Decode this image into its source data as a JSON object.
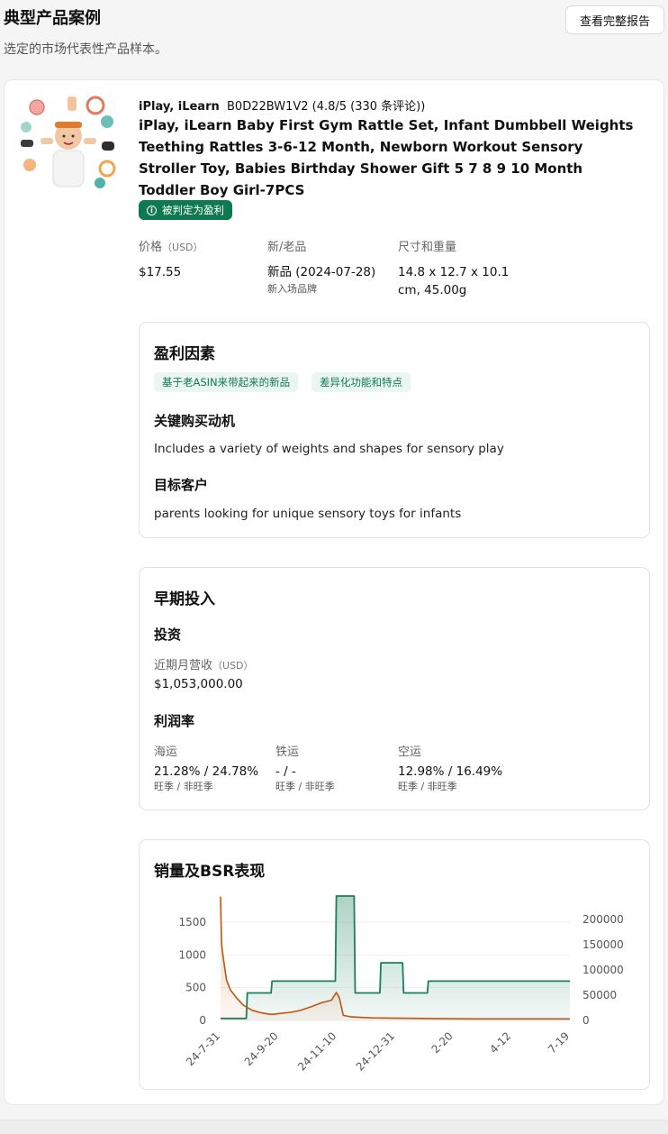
{
  "header": {
    "title": "典型产品案例",
    "subtitle": "选定的市场代表性产品样本。",
    "report_button": "查看完整报告"
  },
  "product": {
    "brand": "iPlay, iLearn",
    "asin_rating": "B0D22BW1V2 (4.8/5 (330 条评论))",
    "title": "iPlay, iLearn Baby First Gym Rattle Set, Infant Dumbbell Weights Teething Rattles 3-6-12 Month, Newborn Workout Sensory Stroller Toy, Babies Birthday Shower Gift 5 7 8 9 10 Month Toddler Boy Girl-7PCS",
    "badge": "被判定为盈利",
    "price_label": "价格",
    "price_unit": "（USD）",
    "price_value": "$17.55",
    "age_label": "新/老品",
    "age_value": "新品 (2024-07-28)",
    "age_sub": "新入场品牌",
    "size_label": "尺寸和重量",
    "size_value": "14.8 x 12.7 x 10.1 cm, 45.00g"
  },
  "profit_factors": {
    "title": "盈利因素",
    "tags": [
      "基于老ASIN来带起来的新品",
      "差异化功能和特点"
    ],
    "motive_title": "关键购买动机",
    "motive_text": "Includes a variety of weights and shapes for sensory play",
    "customer_title": "目标客户",
    "customer_text": "parents looking for unique sensory toys for infants"
  },
  "early_investment": {
    "title": "早期投入",
    "invest_title": "投资",
    "revenue_label": "近期月营收",
    "revenue_unit": "（USD）",
    "revenue_value": "$1,053,000.00",
    "margin_title": "利润率",
    "margins": [
      {
        "label": "海运",
        "value": "21.28% / 24.78%",
        "hint": "旺季 / 非旺季"
      },
      {
        "label": "铁运",
        "value": "- / -",
        "hint": "旺季 / 非旺季"
      },
      {
        "label": "空运",
        "value": "12.98% / 16.49%",
        "hint": "旺季 / 非旺季"
      }
    ]
  },
  "sales_bsr": {
    "title": "销量及BSR表现"
  },
  "colors": {
    "accent_green": "#0f7a52",
    "sales_line": "#1a7f5a",
    "bsr_line": "#c0560e"
  },
  "chart_data": {
    "type": "line",
    "title": "销量及BSR表现",
    "x_tick_labels": [
      "24-7-31",
      "24-9-20",
      "24-11-10",
      "24-12-31",
      "2-20",
      "4-12",
      "7-19"
    ],
    "left_axis": {
      "ticks": [
        0,
        500,
        1000,
        1500
      ],
      "range": [
        0,
        1900
      ]
    },
    "right_axis": {
      "ticks": [
        0,
        50000,
        100000,
        150000,
        200000
      ],
      "range": [
        0,
        246000
      ]
    },
    "series": [
      {
        "axis": "left",
        "color": "#1a7f5a",
        "fill": true,
        "points": [
          [
            "24-7-31",
            30
          ],
          [
            "24-8-26",
            30
          ],
          [
            "24-8-27",
            420
          ],
          [
            "24-9-20",
            420
          ],
          [
            "24-9-21",
            600
          ],
          [
            "24-11-24",
            600
          ],
          [
            "24-11-25",
            1900
          ],
          [
            "24-12-13",
            1900
          ],
          [
            "24-12-14",
            420
          ],
          [
            "25-1-8",
            420
          ],
          [
            "25-1-9",
            880
          ],
          [
            "25-1-31",
            880
          ],
          [
            "25-2-1",
            420
          ],
          [
            "25-2-25",
            420
          ],
          [
            "25-2-26",
            600
          ],
          [
            "25-7-19",
            600
          ]
        ]
      },
      {
        "axis": "right",
        "color": "#c0560e",
        "fill": true,
        "points": [
          [
            "24-7-31",
            245000
          ],
          [
            "24-8-1",
            150000
          ],
          [
            "24-8-3",
            120000
          ],
          [
            "24-8-6",
            80000
          ],
          [
            "24-8-10",
            60000
          ],
          [
            "24-8-16",
            45000
          ],
          [
            "24-8-23",
            30000
          ],
          [
            "24-9-1",
            20000
          ],
          [
            "24-9-10",
            15000
          ],
          [
            "24-9-20",
            12000
          ],
          [
            "24-10-1",
            14000
          ],
          [
            "24-10-10",
            16000
          ],
          [
            "24-10-20",
            20000
          ],
          [
            "24-11-1",
            28000
          ],
          [
            "24-11-10",
            35000
          ],
          [
            "24-11-20",
            40000
          ],
          [
            "24-11-25",
            55000
          ],
          [
            "24-11-28",
            45000
          ],
          [
            "24-12-2",
            10000
          ],
          [
            "24-12-10",
            7000
          ],
          [
            "24-12-31",
            5000
          ],
          [
            "25-2-20",
            4000
          ],
          [
            "25-4-12",
            3000
          ],
          [
            "25-7-19",
            3000
          ]
        ]
      }
    ]
  }
}
